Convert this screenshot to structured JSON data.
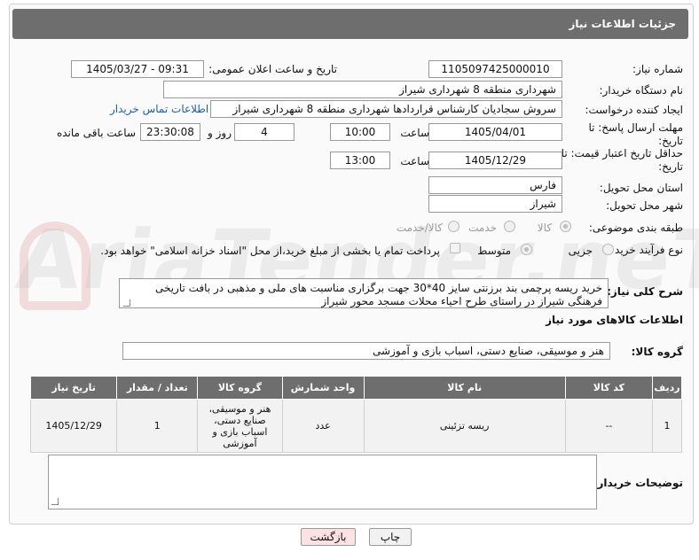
{
  "header": {
    "title": "جزئیات اطلاعات نیاز"
  },
  "form": {
    "need_number": {
      "label": "شماره نیاز:",
      "value": "1105097425000010"
    },
    "announce_datetime": {
      "label": "تاریخ و ساعت اعلان عمومی:",
      "value": "1405/03/27 - 09:31"
    },
    "buyer_org": {
      "label": "نام دستگاه خریدار:",
      "value": "شهرداری منطقه 8 شهرداری شیراز"
    },
    "requester": {
      "label": "ایجاد کننده درخواست:",
      "value": "سروش سجادیان کارشناس قراردادها شهرداری منطقه 8 شهرداری شیراز",
      "contact_link": "اطلاعات تماس خریدار"
    },
    "deadline": {
      "label": "مهلت ارسال پاسخ: تا تاریخ:",
      "date": "1405/04/01",
      "time_label": "ساعت",
      "time": "10:00",
      "days": "4",
      "days_label": "روز و",
      "remaining": "23:30:08",
      "remaining_label": "ساعت باقی مانده"
    },
    "price_validity": {
      "label": "حداقل تاریخ اعتبار قیمت: تا تاریخ:",
      "date": "1405/12/29",
      "time_label": "ساعت",
      "time": "13:00"
    },
    "province": {
      "label": "استان محل تحویل:",
      "value": "فارس"
    },
    "city": {
      "label": "شهر محل تحویل:",
      "value": "شیراز"
    },
    "category": {
      "label": "طبقه بندی موضوعی:",
      "options": [
        "کالا",
        "خدمت",
        "کالا/خدمت"
      ],
      "selected": "کالا"
    },
    "purchase_type": {
      "label": "نوع فرآیند خرید :",
      "options": [
        "جزیی",
        "متوسط"
      ],
      "selected": "متوسط",
      "payment_note": "پرداخت تمام یا بخشی از مبلغ خرید،از محل \"اسناد خزانه اسلامی\" خواهد بود."
    }
  },
  "description": {
    "label": "شرح کلی نیاز:",
    "text": "خرید ریسه پرچمی بند برزنتی سایز 40*30 جهت برگزاری مناسبت های ملی و مذهبی در بافت تاریخی فرهنگی شیراز در راستای طرح احیاء محلات مسجد محور شیراز"
  },
  "goods_section": {
    "title": "اطلاعات کالاهای مورد نیاز",
    "group_label": "گروه کالا:",
    "group_value": "هنر و موسیقی، صنایع دستی، اسباب بازی و آموزشی"
  },
  "items_table": {
    "headers": [
      "ردیف",
      "کد کالا",
      "نام کالا",
      "واحد شمارش",
      "گروه کالا",
      "تعداد / مقدار",
      "تاریخ نیاز"
    ],
    "rows": [
      [
        "1",
        "--",
        "ریسه تزئینی",
        "عدد",
        "هنر و موسیقی، صنایع دستی، اسباب بازی و آموزشی",
        "1",
        "1405/12/29"
      ]
    ]
  },
  "buyer_notes": {
    "label": "توضیحات خریدار:",
    "value": ""
  },
  "buttons": {
    "print": "چاپ",
    "back": "بازگشت"
  },
  "watermark": "AriaTender.neT",
  "colors": {
    "titlebar": "#6e6e6e",
    "link": "#1a5fb4",
    "back_button": "#fde2e2"
  }
}
